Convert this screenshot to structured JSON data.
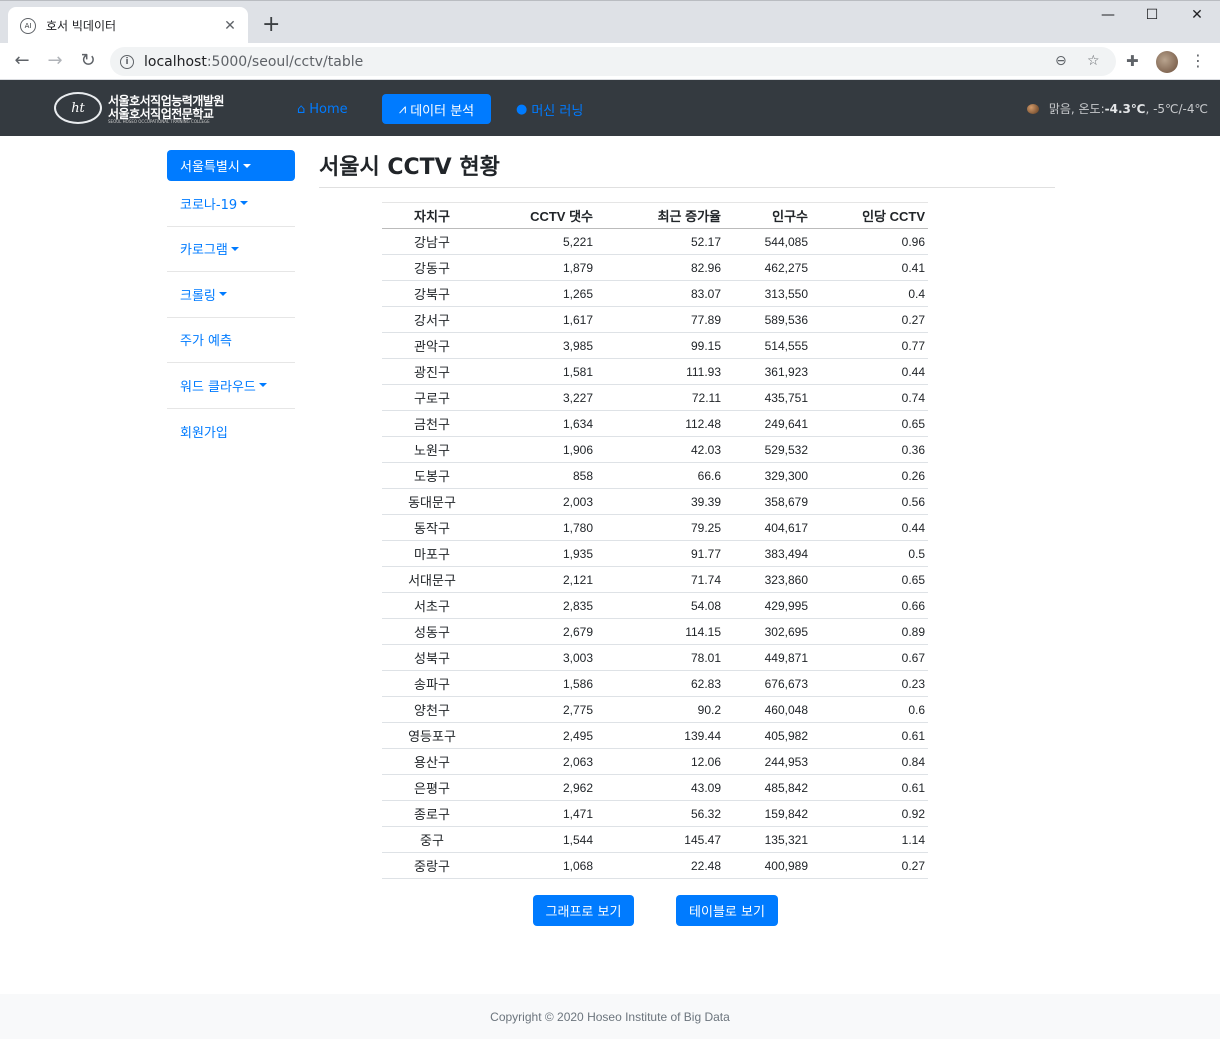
{
  "browser": {
    "tab_title": "호서 빅데이터",
    "favicon": "AI",
    "url_host": "localhost",
    "url_path": ":5000/seoul/cctv/table"
  },
  "navbar": {
    "logo_line1": "서울호서직업능력개발원",
    "logo_line2": "서울호서직업전문학교",
    "logo_line3": "SEOUL HOSEO OCCUPATIONAL TRAINING COLLEGE",
    "logo_mark": "ht",
    "home": "Home",
    "data_analysis": "데이터 분석",
    "machine_learning": "머신 러닝",
    "weather_prefix": "맑음, 온도: ",
    "weather_temp": "-4.3℃",
    "weather_range": ", -5℃/-4℃"
  },
  "sidebar": {
    "active": "서울특별시",
    "items": [
      "코로나-19",
      "카로그램",
      "크롤링",
      "주가 예측",
      "워드 클라우드",
      "회원가입"
    ]
  },
  "main": {
    "title": "서울시 CCTV 현황",
    "headers": [
      "자치구",
      "CCTV 댓수",
      "최근 증가율",
      "인구수",
      "인당 CCTV"
    ],
    "rows": [
      [
        "강남구",
        "5,221",
        "52.17",
        "544,085",
        "0.96"
      ],
      [
        "강동구",
        "1,879",
        "82.96",
        "462,275",
        "0.41"
      ],
      [
        "강북구",
        "1,265",
        "83.07",
        "313,550",
        "0.4"
      ],
      [
        "강서구",
        "1,617",
        "77.89",
        "589,536",
        "0.27"
      ],
      [
        "관악구",
        "3,985",
        "99.15",
        "514,555",
        "0.77"
      ],
      [
        "광진구",
        "1,581",
        "111.93",
        "361,923",
        "0.44"
      ],
      [
        "구로구",
        "3,227",
        "72.11",
        "435,751",
        "0.74"
      ],
      [
        "금천구",
        "1,634",
        "112.48",
        "249,641",
        "0.65"
      ],
      [
        "노원구",
        "1,906",
        "42.03",
        "529,532",
        "0.36"
      ],
      [
        "도봉구",
        "858",
        "66.6",
        "329,300",
        "0.26"
      ],
      [
        "동대문구",
        "2,003",
        "39.39",
        "358,679",
        "0.56"
      ],
      [
        "동작구",
        "1,780",
        "79.25",
        "404,617",
        "0.44"
      ],
      [
        "마포구",
        "1,935",
        "91.77",
        "383,494",
        "0.5"
      ],
      [
        "서대문구",
        "2,121",
        "71.74",
        "323,860",
        "0.65"
      ],
      [
        "서초구",
        "2,835",
        "54.08",
        "429,995",
        "0.66"
      ],
      [
        "성동구",
        "2,679",
        "114.15",
        "302,695",
        "0.89"
      ],
      [
        "성북구",
        "3,003",
        "78.01",
        "449,871",
        "0.67"
      ],
      [
        "송파구",
        "1,586",
        "62.83",
        "676,673",
        "0.23"
      ],
      [
        "양천구",
        "2,775",
        "90.2",
        "460,048",
        "0.6"
      ],
      [
        "영등포구",
        "2,495",
        "139.44",
        "405,982",
        "0.61"
      ],
      [
        "용산구",
        "2,063",
        "12.06",
        "244,953",
        "0.84"
      ],
      [
        "은평구",
        "2,962",
        "43.09",
        "485,842",
        "0.61"
      ],
      [
        "종로구",
        "1,471",
        "56.32",
        "159,842",
        "0.92"
      ],
      [
        "중구",
        "1,544",
        "145.47",
        "135,321",
        "1.14"
      ],
      [
        "중랑구",
        "1,068",
        "22.48",
        "400,989",
        "0.27"
      ]
    ],
    "btn_graph": "그래프로 보기",
    "btn_table": "테이블로 보기"
  },
  "footer": "Copyright © 2020 Hoseo Institute of Big Data",
  "colors": {
    "primary": "#007bff",
    "navbar": "#343a40"
  }
}
